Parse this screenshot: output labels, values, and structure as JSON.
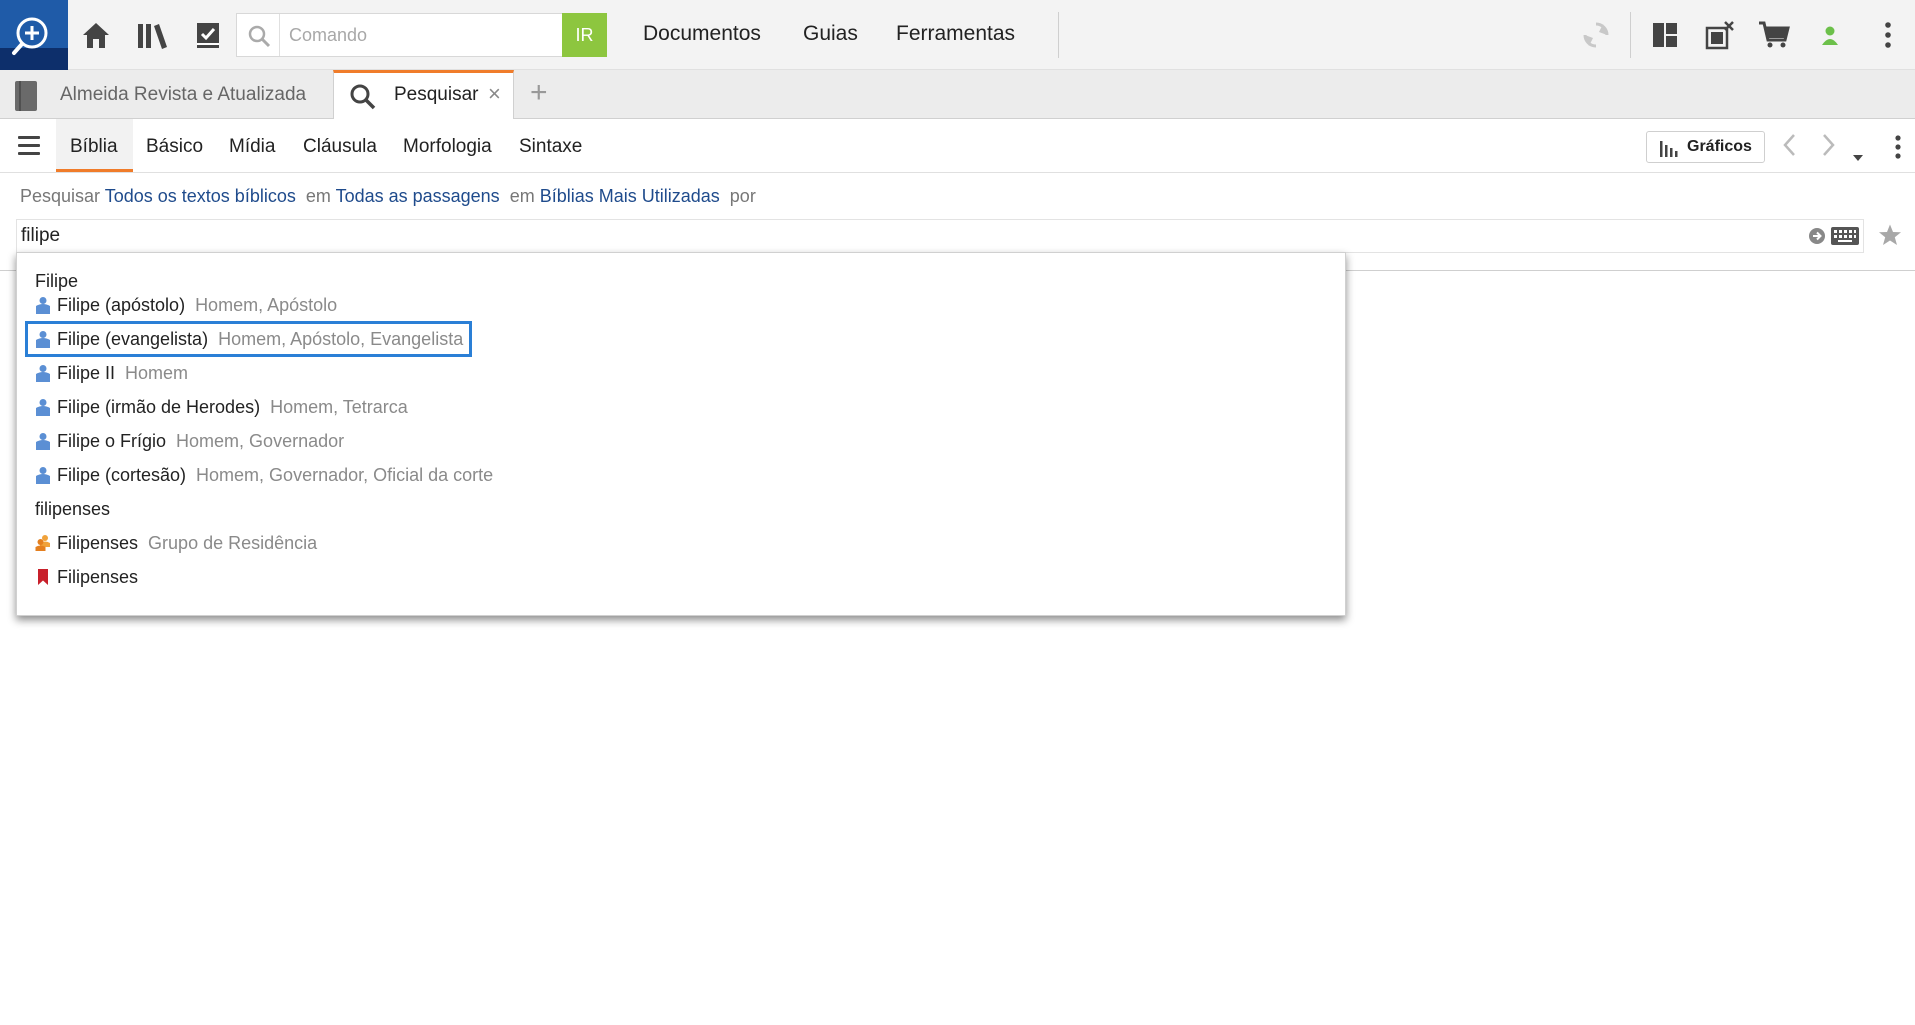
{
  "topbar": {
    "command_placeholder": "Comando",
    "go_label": "IR",
    "menus": [
      "Documentos",
      "Guias",
      "Ferramentas"
    ]
  },
  "tabs": {
    "tab1_label": "Almeida Revista e Atualizada",
    "tab2_label": "Pesquisar",
    "close_glyph": "×",
    "add_glyph": "+"
  },
  "search_tabs": [
    "Bíblia",
    "Básico",
    "Mídia",
    "Cláusula",
    "Morfologia",
    "Sintaxe"
  ],
  "toolbar": {
    "graphs_label": "Gráficos"
  },
  "scope": {
    "prefix": "Pesquisar",
    "texts": "Todos os textos bíblicos",
    "in1": "em",
    "passages": "Todas as passagens",
    "in2": "em",
    "bibles": "Bíblias Mais Utilizadas",
    "by": "por"
  },
  "query": "filipe",
  "dropdown": {
    "group1": "Filipe",
    "people": [
      {
        "name": "Filipe (apóstolo)",
        "desc": "Homem, Apóstolo"
      },
      {
        "name": "Filipe (evangelista)",
        "desc": "Homem, Apóstolo, Evangelista"
      },
      {
        "name": "Filipe II",
        "desc": "Homem"
      },
      {
        "name": "Filipe (irmão de Herodes)",
        "desc": "Homem, Tetrarca"
      },
      {
        "name": "Filipe o Frígio",
        "desc": "Homem, Governador"
      },
      {
        "name": "Filipe (cortesão)",
        "desc": "Homem, Governador, Oficial da corte"
      }
    ],
    "group2": "filipenses",
    "group_item": {
      "name": "Filipenses",
      "desc": "Grupo de Residência"
    },
    "book_item": {
      "name": "Filipenses"
    }
  },
  "colors": {
    "accent": "#f07c2a",
    "go": "#8dc63f",
    "link": "#1f4b8c",
    "selection": "#2a7fd6",
    "person": "#5b8fd4",
    "group": "#f0a23a",
    "book": "#c8202b"
  }
}
